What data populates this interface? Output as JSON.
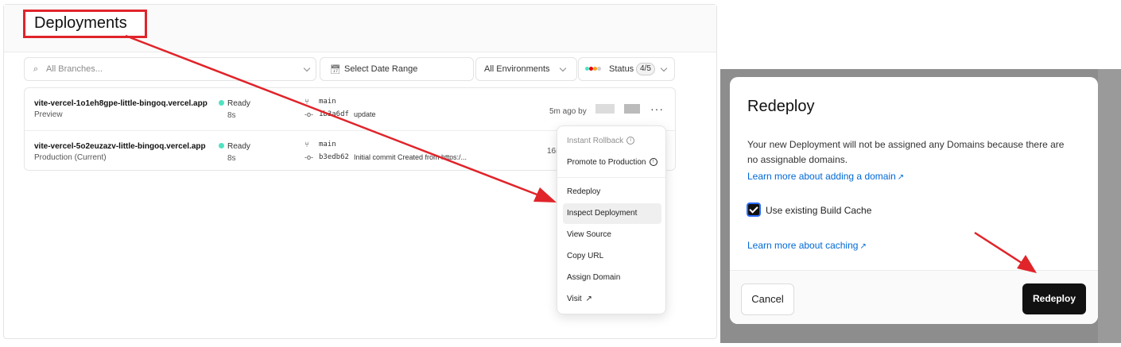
{
  "colors": {
    "accent_red": "#e0242a",
    "ready_green": "#50e3c2",
    "link_blue": "#0068d6",
    "button_dark": "#111111"
  },
  "header": {
    "title": "Deployments"
  },
  "filters": {
    "search_placeholder": "All Branches...",
    "date_range": "Select Date Range",
    "environments": "All Environments",
    "status_label": "Status",
    "status_count": "4/5"
  },
  "deployments": [
    {
      "url": "vite-vercel-1o1eh8gpe-little-bingoq.vercel.app",
      "environment": "Preview",
      "status": "Ready",
      "duration": "8s",
      "branch": "main",
      "commit_sha": "1b3a6df",
      "commit_message": "update",
      "age": "5m ago by"
    },
    {
      "url": "vite-vercel-5o2euzazv-little-bingoq.vercel.app",
      "environment": "Production (Current)",
      "status": "Ready",
      "duration": "8s",
      "branch": "main",
      "commit_sha": "b3edb62",
      "commit_message": "Initial commit Created from https:/...",
      "age": "16m"
    }
  ],
  "menu": {
    "instant_rollback": "Instant Rollback",
    "promote": "Promote to Production",
    "redeploy": "Redeploy",
    "inspect": "Inspect Deployment",
    "view_source": "View Source",
    "copy_url": "Copy URL",
    "assign_domain": "Assign Domain",
    "visit": "Visit"
  },
  "dialog": {
    "title": "Redeploy",
    "description": "Your new Deployment will not be assigned any Domains because there are no assignable domains.",
    "domain_link": "Learn more about adding a domain",
    "checkbox_label": "Use existing Build Cache",
    "checkbox_checked": true,
    "caching_link": "Learn more about caching",
    "cancel": "Cancel",
    "redeploy": "Redeploy"
  }
}
